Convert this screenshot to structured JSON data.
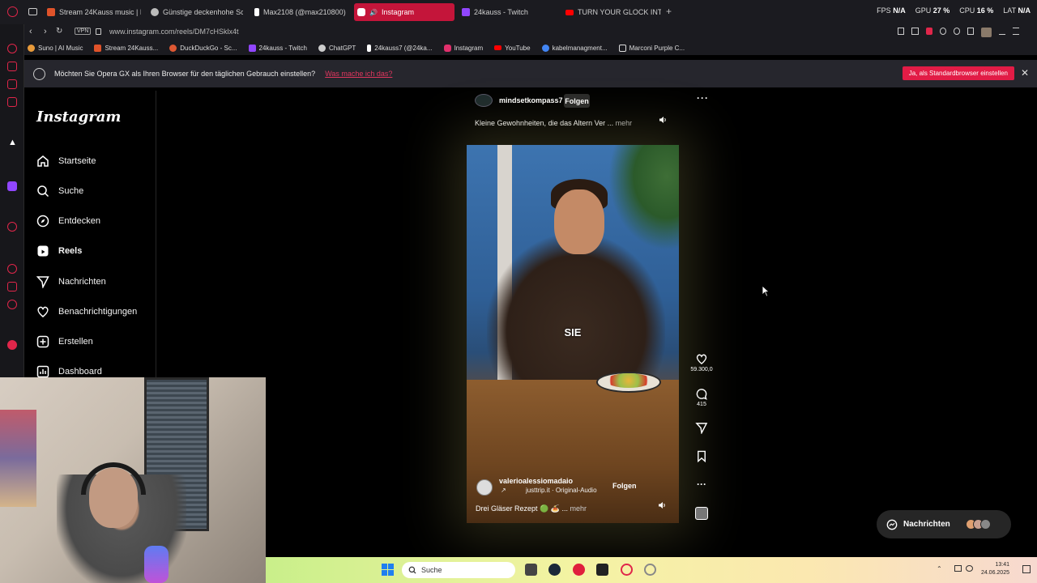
{
  "browser": {
    "tabs": [
      {
        "label": "Stream 24Kauss music | L",
        "color": "#e0532a",
        "active": false
      },
      {
        "label": "Günstige deckenhohe Sc",
        "color": "#bbbbbb",
        "active": false
      },
      {
        "label": "Max2108 (@max210800)",
        "color": "#ffffff",
        "active": false
      },
      {
        "label": "Instagram",
        "color": "#e1306c",
        "active": true
      },
      {
        "label": "24kauss - Twitch",
        "color": "#9146ff",
        "active": false
      },
      {
        "label": "TURN YOUR GLOCK INTO",
        "color": "#ff0000",
        "active": false
      }
    ],
    "stats": {
      "fps_label": "FPS",
      "fps_value": "N/A",
      "gpu_label": "GPU",
      "gpu_value": "27 %",
      "cpu_label": "CPU",
      "cpu_value": "16 %",
      "lat_label": "LAT",
      "lat_value": "N/A"
    },
    "vpn_label": "VPN",
    "url": "www.instagram.com/reels/DM7cHSklx4t",
    "bookmarks": [
      {
        "label": "Suno | AI Music",
        "color": "#e89a3a"
      },
      {
        "label": "Stream 24Kauss...",
        "color": "#e0532a"
      },
      {
        "label": "DuckDuckGo - Sc...",
        "color": "#de5833"
      },
      {
        "label": "24kauss - Twitch",
        "color": "#9146ff"
      },
      {
        "label": "ChatGPT",
        "color": "#cccccc"
      },
      {
        "label": "24kauss7 (@24ka...",
        "color": "#ffffff"
      },
      {
        "label": "Instagram",
        "color": "#e1306c"
      },
      {
        "label": "YouTube",
        "color": "#ff0000"
      },
      {
        "label": "kabelmanagment...",
        "color": "#4285f4"
      },
      {
        "label": "Marconi Purple C...",
        "color": "#dddddd"
      }
    ]
  },
  "banner": {
    "message": "Möchten Sie Opera GX als Ihren Browser für den täglichen Gebrauch einstellen?",
    "link": "Was mache ich das?",
    "button": "Ja, als Standardbrowser einstellen",
    "close": "✕"
  },
  "instagram": {
    "logo": "Instagram",
    "nav": [
      {
        "label": "Startseite",
        "icon": "home-icon"
      },
      {
        "label": "Suche",
        "icon": "search-icon"
      },
      {
        "label": "Entdecken",
        "icon": "compass-icon"
      },
      {
        "label": "Reels",
        "icon": "reels-icon"
      },
      {
        "label": "Nachrichten",
        "icon": "send-icon"
      },
      {
        "label": "Benachrichtigungen",
        "icon": "heart-icon"
      },
      {
        "label": "Erstellen",
        "icon": "plus-square-icon"
      },
      {
        "label": "Dashboard",
        "icon": "chart-icon"
      }
    ],
    "post": {
      "username": "mindsetkompass7",
      "follow": "Folgen",
      "caption": "Kleine Gewohnheiten, die das Altern Ver ...",
      "more": "mehr",
      "overlay_text": "SIE",
      "video_user": "valerioalessiomadaio",
      "video_audio": "justtrip.it · Original-Audio",
      "video_follow": "Folgen",
      "video_caption": "Drei Gläser Rezept 🟢 🍝 ...",
      "video_more": "mehr",
      "likes": "59.300,0",
      "comments": "415"
    },
    "messages_button": "Nachrichten"
  },
  "taskbar": {
    "search_placeholder": "Suche",
    "time": "13:41",
    "date": "24.06.2025"
  }
}
